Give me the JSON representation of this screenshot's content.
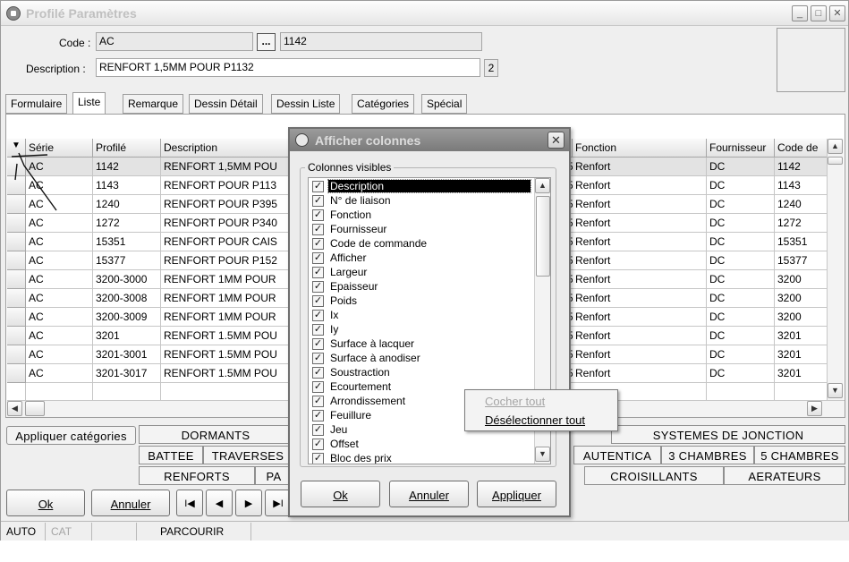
{
  "window": {
    "title": "Profilé Paramètres",
    "min": "_",
    "max": "□",
    "close": "✕"
  },
  "form": {
    "code_label": "Code :",
    "code_value": "AC",
    "browse_label": "...",
    "code2_value": "1142",
    "description_label": "Description :",
    "description_value": "RENFORT 1,5MM POUR P1132",
    "description_badge": "2"
  },
  "tabs": [
    "Formulaire",
    "Liste",
    "Remarque",
    "Dessin Détail",
    "Dessin Liste",
    "Catégories",
    "Spécial"
  ],
  "grid": {
    "headers": {
      "serie": "Série",
      "profile": "Profilé",
      "description": "Description",
      "fonction": "Fonction",
      "fournisseur": "Fournisseur",
      "code": "Code de"
    },
    "rows": [
      {
        "serie": "AC",
        "profile": "1142",
        "description": "RENFORT 1,5MM POU",
        "fonction": "Renfort",
        "fournisseur": "DC",
        "code": "1142"
      },
      {
        "serie": "AC",
        "profile": "1143",
        "description": "RENFORT POUR P113",
        "fonction": "Renfort",
        "fournisseur": "DC",
        "code": "1143"
      },
      {
        "serie": "AC",
        "profile": "1240",
        "description": "RENFORT POUR P395",
        "fonction": "Renfort",
        "fournisseur": "DC",
        "code": "1240"
      },
      {
        "serie": "AC",
        "profile": "1272",
        "description": "RENFORT POUR P340",
        "fonction": "Renfort",
        "fournisseur": "DC",
        "code": "1272"
      },
      {
        "serie": "AC",
        "profile": "15351",
        "description": "RENFORT POUR CAIS",
        "fonction": "Renfort",
        "fournisseur": "DC",
        "code": "15351"
      },
      {
        "serie": "AC",
        "profile": "15377",
        "description": "RENFORT POUR P152",
        "fonction": "Renfort",
        "fournisseur": "DC",
        "code": "15377"
      },
      {
        "serie": "AC",
        "profile": "3200-3000",
        "description": "RENFORT 1MM POUR",
        "fonction": "Renfort",
        "fournisseur": "DC",
        "code": "3200"
      },
      {
        "serie": "AC",
        "profile": "3200-3008",
        "description": "RENFORT 1MM POUR",
        "fonction": "Renfort",
        "fournisseur": "DC",
        "code": "3200"
      },
      {
        "serie": "AC",
        "profile": "3200-3009",
        "description": "RENFORT 1MM POUR",
        "fonction": "Renfort",
        "fournisseur": "DC",
        "code": "3200"
      },
      {
        "serie": "AC",
        "profile": "3201",
        "description": "RENFORT 1.5MM POU",
        "fonction": "Renfort",
        "fournisseur": "DC",
        "code": "3201"
      },
      {
        "serie": "AC",
        "profile": "3201-3001",
        "description": "RENFORT 1.5MM POU",
        "fonction": "Renfort",
        "fournisseur": "DC",
        "code": "3201"
      },
      {
        "serie": "AC",
        "profile": "3201-3017",
        "description": "RENFORT 1.5MM POU",
        "fonction": "Renfort",
        "fournisseur": "DC",
        "code": "3201"
      }
    ],
    "partial_col_digit": "5"
  },
  "categories": {
    "apply_label": "Appliquer catégories",
    "dormants": "DORMANTS",
    "systemes": "SYSTEMES DE JONCTION",
    "battee": "BATTEE",
    "traverses": "TRAVERSES",
    "authentica": "AUTENTICA",
    "chambres3": "3 CHAMBRES",
    "chambres5": "5 CHAMBRES",
    "renforts": "RENFORTS",
    "pa": "PA",
    "croisillants": "CROISILLANTS",
    "aerateurs": "AERATEURS"
  },
  "buttons": {
    "ok": "Ok",
    "annuler": "Annuler",
    "first": "I◀",
    "prev": "◀",
    "next": "▶",
    "last": "▶I"
  },
  "status": {
    "auto": "AUTO",
    "cat": "CAT",
    "mode": "PARCOURIR"
  },
  "dialog": {
    "title": "Afficher colonnes",
    "group_label": "Colonnes visibles",
    "check_mark": "✓",
    "columns": [
      {
        "label": "Description",
        "checked": true
      },
      {
        "label": "N° de liaison",
        "checked": true
      },
      {
        "label": "Fonction",
        "checked": true
      },
      {
        "label": "Fournisseur",
        "checked": true
      },
      {
        "label": "Code de commande",
        "checked": true
      },
      {
        "label": "Afficher",
        "checked": true
      },
      {
        "label": "Largeur",
        "checked": true
      },
      {
        "label": "Epaisseur",
        "checked": true
      },
      {
        "label": "Poids",
        "checked": true
      },
      {
        "label": "Ix",
        "checked": true
      },
      {
        "label": "Iy",
        "checked": true
      },
      {
        "label": "Surface à lacquer",
        "checked": true
      },
      {
        "label": "Surface à anodiser",
        "checked": true
      },
      {
        "label": "Soustraction",
        "checked": true
      },
      {
        "label": "Ecourtement",
        "checked": true
      },
      {
        "label": "Arrondissement",
        "checked": true
      },
      {
        "label": "Feuillure",
        "checked": true
      },
      {
        "label": "Jeu",
        "checked": true
      },
      {
        "label": "Offset",
        "checked": true
      },
      {
        "label": "Bloc des prix",
        "checked": true
      }
    ],
    "ok": "Ok",
    "annuler": "Annuler",
    "appliquer": "Appliquer"
  },
  "context_menu": {
    "cocher_tout": "Cocher tout",
    "deselect_tout": "Désélectionner tout"
  }
}
